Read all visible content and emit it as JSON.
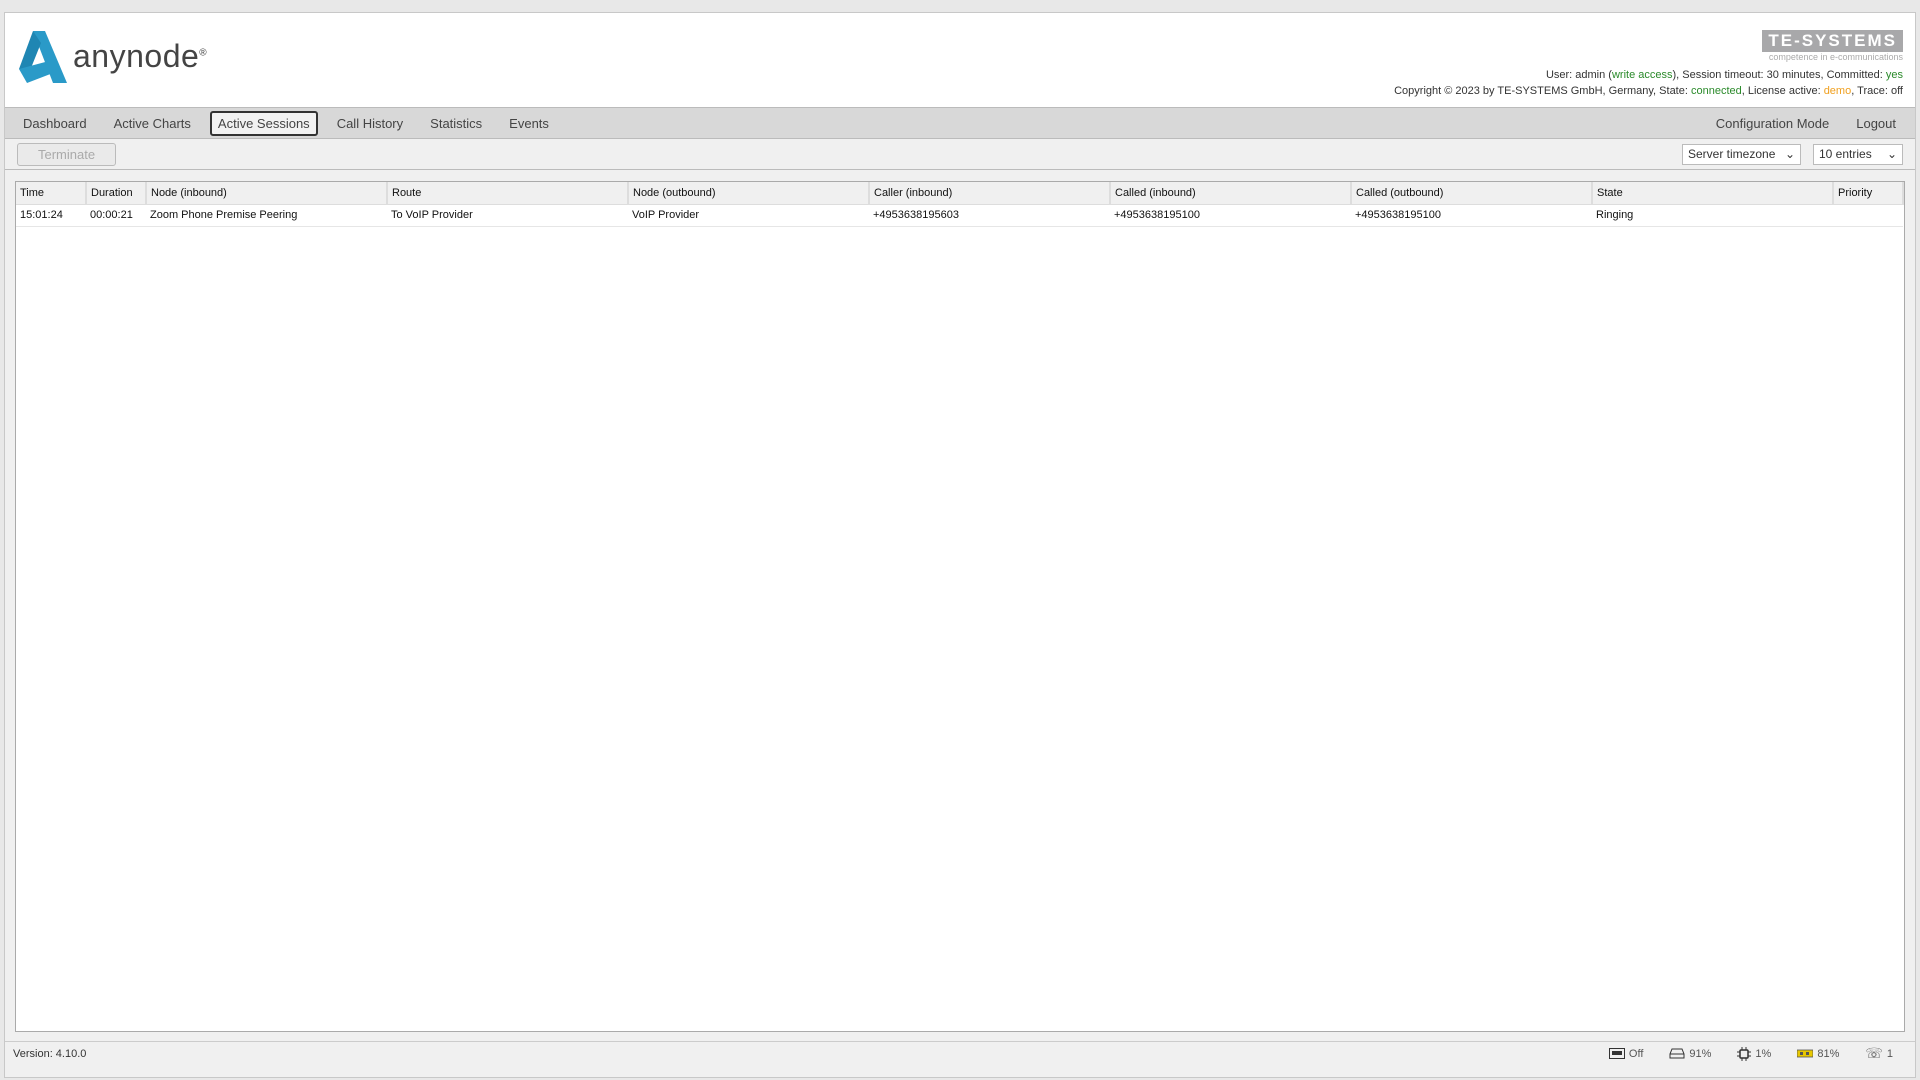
{
  "header": {
    "logo": "anynode",
    "brand": "TE-SYSTEMS",
    "brand_tagline": "competence in e-communications",
    "user_prefix": "User: admin (",
    "user_access": "write access",
    "user_mid": "), Session timeout: 30 minutes, Committed: ",
    "committed": "yes",
    "copy_prefix": "Copyright © 2023 by TE-SYSTEMS GmbH, Germany, State: ",
    "state": "connected",
    "license_prefix": ", License active: ",
    "license": "demo",
    "trace": ", Trace: off"
  },
  "nav": {
    "items": [
      "Dashboard",
      "Active Charts",
      "Active Sessions",
      "Call History",
      "Statistics",
      "Events"
    ],
    "active": "Active Sessions",
    "right": [
      "Configuration Mode",
      "Logout"
    ]
  },
  "toolbar": {
    "terminate": "Terminate",
    "timezone": "Server timezone",
    "entries": "10 entries"
  },
  "table": {
    "columns": [
      "Time",
      "Duration",
      "Node (inbound)",
      "Route",
      "Node (outbound)",
      "Caller (inbound)",
      "Called (inbound)",
      "Called (outbound)",
      "State",
      "Priority"
    ],
    "rows": [
      [
        "15:01:24",
        "00:00:21",
        "Zoom Phone Premise Peering",
        "To VoIP Provider",
        "VoIP Provider",
        "+4953638195603",
        "+4953638195100",
        "+4953638195100",
        "Ringing",
        ""
      ]
    ]
  },
  "status": {
    "version": "Version: 4.10.0",
    "recording": "Off",
    "disk": "91%",
    "cpu": "1%",
    "memory": "81%",
    "calls": "1"
  },
  "colors": {
    "accent": "#2a9ac8",
    "green": "#2a8a2a",
    "orange": "#f0a020"
  }
}
